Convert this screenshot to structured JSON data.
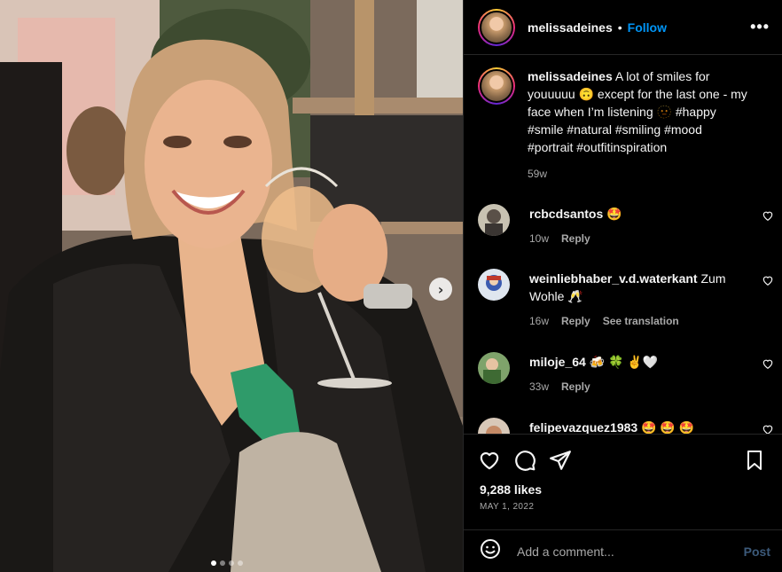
{
  "post": {
    "username": "melissadeines",
    "separator": "•",
    "follow_label": "Follow",
    "more_icon": "more-horizontal-icon",
    "more_label": "•••",
    "next_label": "›",
    "carousel": {
      "count": 4,
      "active_index": 0
    }
  },
  "caption": {
    "username": "melissadeines",
    "text": " A lot of smiles for youuuuu 🙃 except for the last one - my face when I’m listening 🫥 #happy #smile #natural #smiling #mood #portrait #outfitinspiration",
    "time": "59w"
  },
  "comments": [
    {
      "username": "rcbcdsantos",
      "text": " 🤩",
      "time": "10w",
      "reply_label": "Reply",
      "translation_label": ""
    },
    {
      "username": "weinliebhaber_v.d.waterkant",
      "text": " Zum Wohle 🥂",
      "time": "16w",
      "reply_label": "Reply",
      "translation_label": "See translation"
    },
    {
      "username": "miloje_64",
      "text": " 🍻 🍀 ✌🤍",
      "time": "33w",
      "reply_label": "Reply",
      "translation_label": ""
    },
    {
      "username": "felipevazquez1983",
      "text": " 🤩 🤩 🤩",
      "time": "",
      "reply_label": "",
      "translation_label": ""
    }
  ],
  "actions": {
    "likes": "9,288 likes",
    "date": "MAY 1, 2022"
  },
  "add_comment": {
    "placeholder": "Add a comment...",
    "post_label": "Post"
  },
  "colors": {
    "accent": "#0095f6",
    "post_disabled": "#3c5a7a",
    "muted": "#a8a8a8",
    "background": "#000000"
  }
}
